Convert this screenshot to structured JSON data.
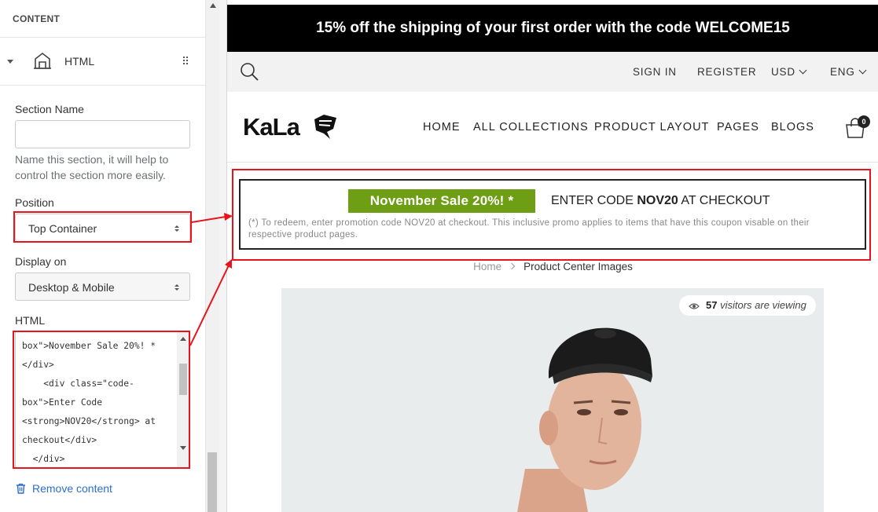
{
  "editor": {
    "header": "CONTENT",
    "block_title": "HTML",
    "section_name_label": "Section Name",
    "section_name_value": "",
    "section_help": "Name this section, it will help to control the section more easily.",
    "position_label": "Position",
    "position_value": "Top Container",
    "display_label": "Display on",
    "display_value": "Desktop & Mobile",
    "html_label": "HTML",
    "html_code": "box\">November Sale 20%! *\n</div>\n    <div class=\"code-\nbox\">Enter Code\n<strong>NOV20</strong> at\ncheckout</div>\n  </div>",
    "remove_label": "Remove content"
  },
  "store": {
    "announcement": "15% off the shipping of your first order with the code WELCOME15",
    "top_links": {
      "sign_in": "SIGN IN",
      "register": "REGISTER",
      "currency": "USD",
      "language": "ENG"
    },
    "logo": "KaLa",
    "nav": [
      "HOME",
      "ALL COLLECTIONS",
      "PRODUCT LAYOUT",
      "PAGES",
      "BLOGS"
    ],
    "cart_count": "0",
    "sale": {
      "badge": "November Sale 20%! *",
      "code_prefix": "ENTER CODE ",
      "code": "NOV20",
      "code_suffix": " AT CHECKOUT",
      "fine_print": "(*) To redeem, enter promotion code NOV20 at checkout. This inclusive promo applies to items that have this coupon visable on their respective product pages."
    },
    "breadcrumb": {
      "home": "Home",
      "current": "Product Center Images"
    },
    "viewers": {
      "count": "57",
      "text": " visitors are viewing"
    }
  },
  "colors": {
    "annotation_red": "#e8131b",
    "sale_green": "#6e9e14",
    "link_blue": "#2c6ecb"
  }
}
